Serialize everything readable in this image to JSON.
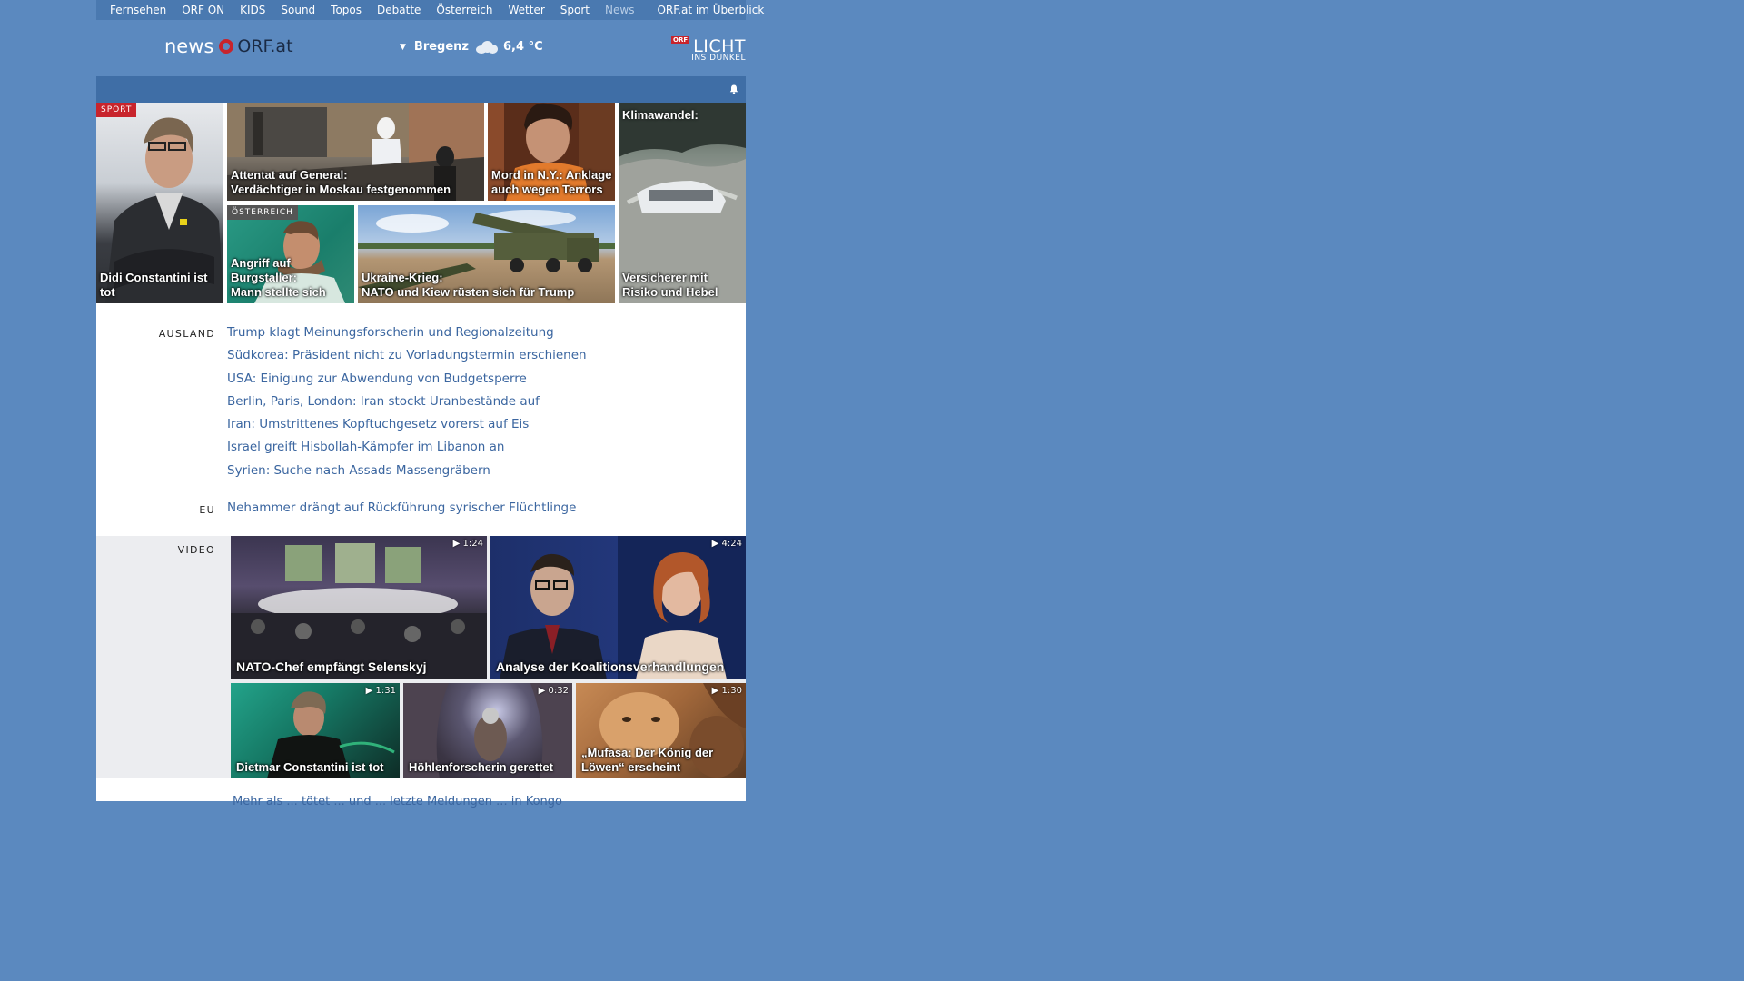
{
  "topnav": {
    "items": [
      "Fernsehen",
      "ORF ON",
      "KIDS",
      "Sound",
      "Topos",
      "Debatte",
      "Österreich",
      "Wetter",
      "Sport",
      "News"
    ],
    "overview": "ORF.at im Überblick"
  },
  "header": {
    "logo_news": "news",
    "logo_orf": "ORF.at",
    "weather_city": "Bregenz",
    "weather_temp": "6,4 °C",
    "weather_icon": "cloud-icon",
    "licht_tag": "ORF",
    "licht_big": "LICHT",
    "licht_small": "INS DUNKEL"
  },
  "tiles": {
    "t1": {
      "badge": "SPORT",
      "caption": "Didi Constantini ist tot"
    },
    "t2": {
      "caption1": "Attentat auf General:",
      "caption2": "Verdächtiger in Moskau festgenommen"
    },
    "t3": {
      "caption1": "Mord in N.Y.: Anklage",
      "caption2": "auch wegen Terrors"
    },
    "t4": {
      "topcap": "Klimawandel:",
      "caption1": "Versicherer mit",
      "caption2": "Risiko und Hebel"
    },
    "t5": {
      "badge": "ÖSTERREICH",
      "caption1": "Angriff auf Burgstaller:",
      "caption2": "Mann stellte sich"
    },
    "t6": {
      "caption1": "Ukraine-Krieg:",
      "caption2": "NATO und Kiew rüsten sich für Trump"
    }
  },
  "ausland": {
    "label": "AUSLAND",
    "items": [
      "Trump klagt Meinungsforscherin und Regionalzeitung",
      "Südkorea: Präsident nicht zu Vorladungstermin erschienen",
      "USA: Einigung zur Abwendung von Budgetsperre",
      "Berlin, Paris, London: Iran stockt Uranbestände auf",
      "Iran: Umstrittenes Kopftuchgesetz vorerst auf Eis",
      "Israel greift Hisbollah-Kämpfer im Libanon an",
      "Syrien: Suche nach Assads Massengräbern"
    ]
  },
  "eu": {
    "label": "EU",
    "items": [
      "Nehammer drängt auf Rückführung syrischer Flüchtlinge"
    ]
  },
  "video": {
    "label": "VIDEO",
    "v1": {
      "duration": "1:24",
      "caption": "NATO-Chef empfängt Selenskyj"
    },
    "v2": {
      "duration": "4:24",
      "caption": "Analyse der Koalitionsverhandlungen"
    },
    "v3": {
      "duration": "1:31",
      "caption": "Dietmar Constantini ist tot"
    },
    "v4": {
      "duration": "0:32",
      "caption": "Höhlenforscherin gerettet"
    },
    "v5": {
      "duration": "1:30",
      "caption1": "„Mufasa: Der König der",
      "caption2": "Löwen“ erscheint"
    }
  },
  "bottom": {
    "partial": "Mehr als ... tötet ... und ... letzte Meldungen ... in Kongo"
  },
  "colors": {
    "background": "#5b89bf",
    "accent_red": "#c8242c",
    "link": "#3b66a0"
  }
}
